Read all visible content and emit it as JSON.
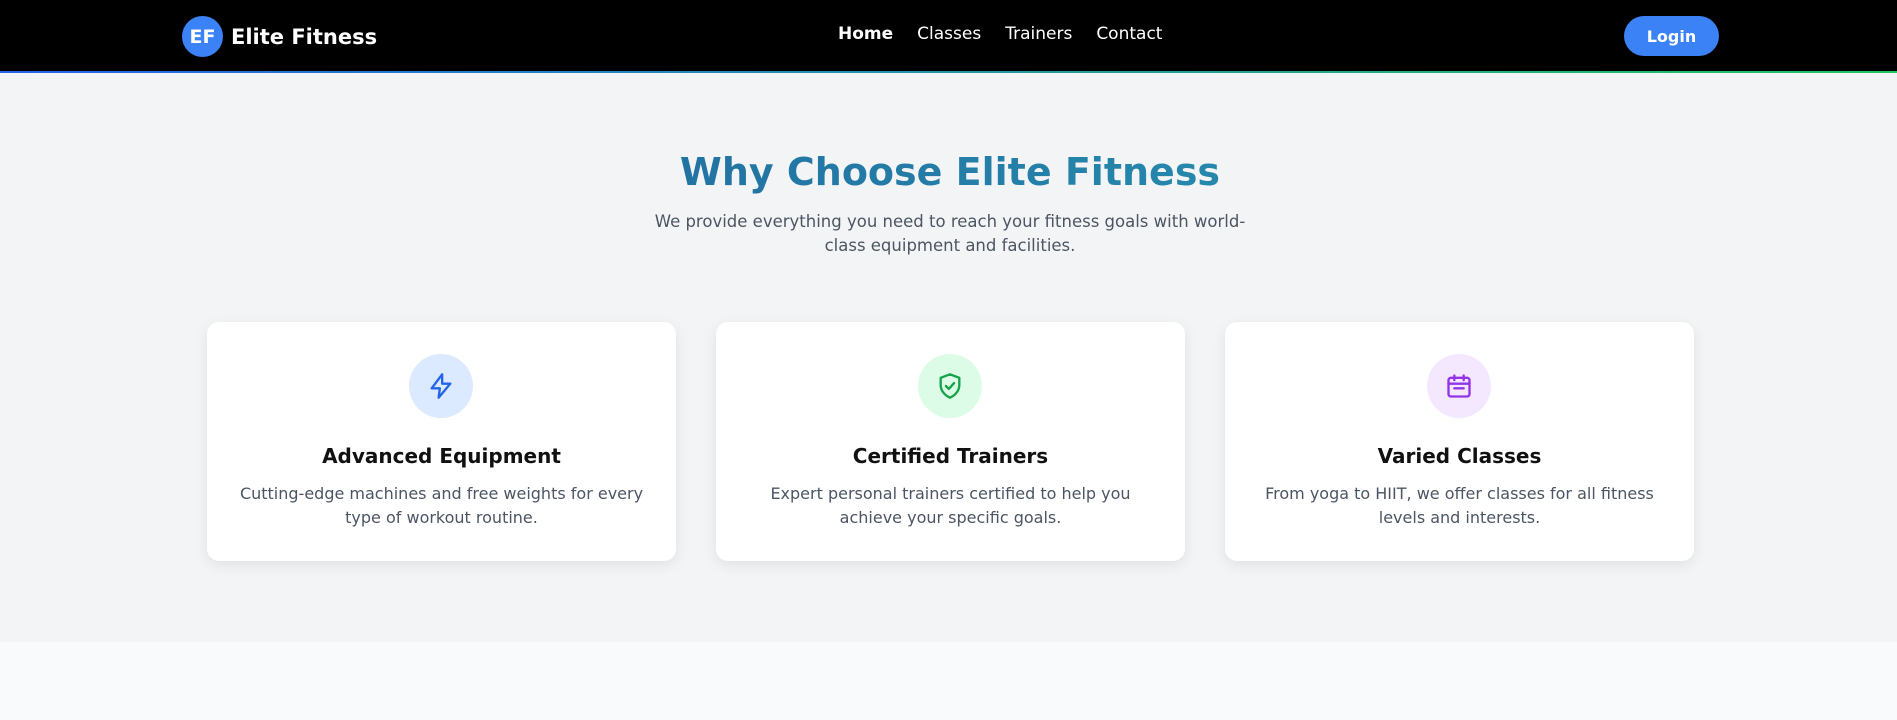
{
  "nav": {
    "brand_badge": "EF",
    "brand_name": "Elite Fitness",
    "links": [
      "Home",
      "Classes",
      "Trainers",
      "Contact"
    ],
    "active_link": "Home",
    "login_label": "Login"
  },
  "hero": {
    "title": "Why Choose Elite Fitness",
    "subtitle": "We provide everything you need to reach your fitness goals with world-class equipment and facilities."
  },
  "features": [
    {
      "icon": "lightning-icon",
      "icon_color": "#2563eb",
      "icon_bg": "#dbeafe",
      "title": "Advanced Equipment",
      "description": "Cutting-edge machines and free weights for every type of workout routine."
    },
    {
      "icon": "shield-check-icon",
      "icon_color": "#16a34a",
      "icon_bg": "#dcfce7",
      "title": "Certified Trainers",
      "description": "Expert personal trainers certified to help you achieve your specific goals."
    },
    {
      "icon": "calendar-icon",
      "icon_color": "#9333ea",
      "icon_bg": "#f3e8ff",
      "title": "Varied Classes",
      "description": "From yoga to HIIT, we offer classes for all fitness levels and interests."
    }
  ],
  "colors": {
    "navbar_bg": "#000000",
    "accent": "#3b82f6",
    "page_bg": "#f3f4f6",
    "title_gradient_start": "#1e5a96",
    "title_gradient_end": "#2aa0b8"
  }
}
